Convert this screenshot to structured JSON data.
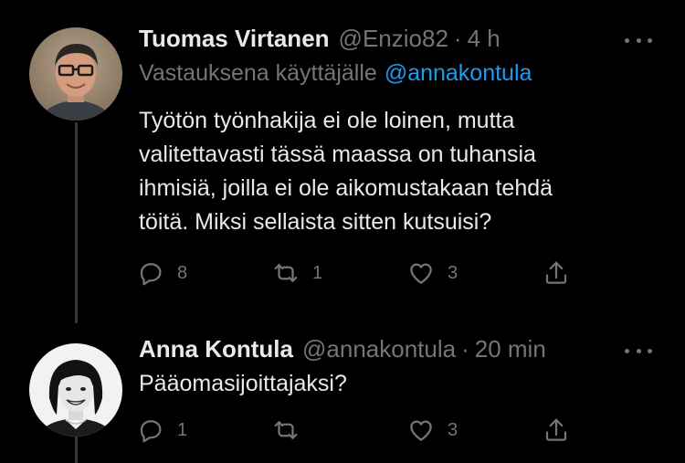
{
  "tweets": [
    {
      "name": "Tuomas Virtanen",
      "handle": "@Enzio82",
      "separator": "·",
      "time": "4 h",
      "reply_prefix": "Vastauksena käyttäjälle",
      "reply_mention": "@annakontula",
      "text": "Työtön työnhakija ei ole loinen, mutta\nvalitettavasti tässä maassa on tuhansia\nihmisiä, joilla ei ole aikomustakaan tehdä\ntöitä. Miksi sellaista sitten kutsuisi?",
      "replies": "8",
      "retweets": "1",
      "likes": "3"
    },
    {
      "name": "Anna Kontula",
      "handle": "@annakontula",
      "separator": "·",
      "time": "20 min",
      "text": "Pääomasijoittajaksi?",
      "replies": "1",
      "retweets": "",
      "likes": "3"
    }
  ],
  "icons": {
    "reply": "reply-icon",
    "retweet": "retweet-icon",
    "like": "heart-icon",
    "share": "share-icon",
    "more": "more-icon"
  },
  "colors": {
    "background": "#000000",
    "text": "#e7e9ea",
    "secondary": "#71767b",
    "link": "#1d9bf0",
    "thread_line": "#333639"
  }
}
